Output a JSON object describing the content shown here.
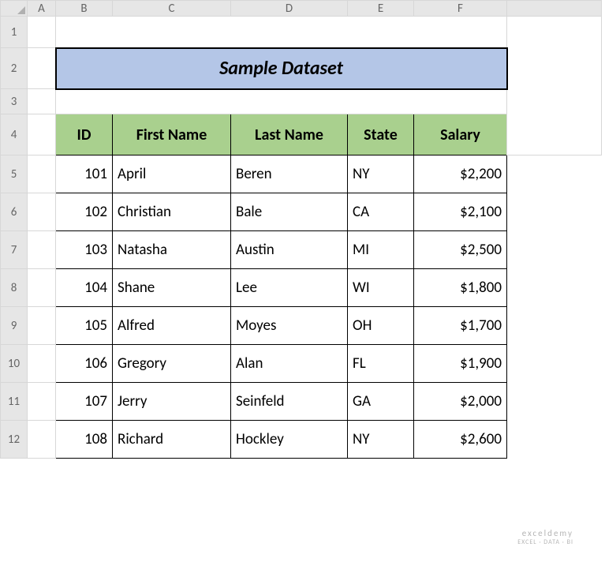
{
  "columns": [
    "A",
    "B",
    "C",
    "D",
    "E",
    "F"
  ],
  "rowNumbers": [
    "1",
    "2",
    "3",
    "4",
    "5",
    "6",
    "7",
    "8",
    "9",
    "10",
    "11",
    "12"
  ],
  "colWidths": {
    "rowhead": 34,
    "A": 36,
    "B": 72,
    "C": 150,
    "D": 148,
    "E": 84,
    "F": 118
  },
  "rowHeights": {
    "colhead": 20,
    "1": 40,
    "2": 52,
    "3": 32,
    "4": 52,
    "data": 48
  },
  "title": "Sample Dataset",
  "headers": [
    "ID",
    "First Name",
    "Last Name",
    "State",
    "Salary"
  ],
  "rows": [
    {
      "id": "101",
      "first": "April",
      "last": "Beren",
      "state": "NY",
      "salary": "$2,200"
    },
    {
      "id": "102",
      "first": "Christian",
      "last": "Bale",
      "state": "CA",
      "salary": "$2,100"
    },
    {
      "id": "103",
      "first": "Natasha",
      "last": "Austin",
      "state": "MI",
      "salary": "$2,500"
    },
    {
      "id": "104",
      "first": "Shane",
      "last": "Lee",
      "state": "WI",
      "salary": "$1,800"
    },
    {
      "id": "105",
      "first": "Alfred",
      "last": "Moyes",
      "state": "OH",
      "salary": "$1,700"
    },
    {
      "id": "106",
      "first": "Gregory",
      "last": "Alan",
      "state": "FL",
      "salary": "$1,900"
    },
    {
      "id": "107",
      "first": "Jerry",
      "last": "Seinfeld",
      "state": "GA",
      "salary": "$2,000"
    },
    {
      "id": "108",
      "first": "Richard",
      "last": "Hockley",
      "state": "NY",
      "salary": "$2,600"
    }
  ],
  "watermark": {
    "main": "exceldemy",
    "sub": "EXCEL · DATA · BI"
  },
  "chart_data": {
    "type": "table",
    "title": "Sample Dataset",
    "columns": [
      "ID",
      "First Name",
      "Last Name",
      "State",
      "Salary"
    ],
    "rows": [
      [
        101,
        "April",
        "Beren",
        "NY",
        2200
      ],
      [
        102,
        "Christian",
        "Bale",
        "CA",
        2100
      ],
      [
        103,
        "Natasha",
        "Austin",
        "MI",
        2500
      ],
      [
        104,
        "Shane",
        "Lee",
        "WI",
        1800
      ],
      [
        105,
        "Alfred",
        "Moyes",
        "OH",
        1700
      ],
      [
        106,
        "Gregory",
        "Alan",
        "FL",
        1900
      ],
      [
        107,
        "Jerry",
        "Seinfeld",
        "GA",
        2000
      ],
      [
        108,
        "Richard",
        "Hockley",
        "NY",
        2600
      ]
    ]
  }
}
